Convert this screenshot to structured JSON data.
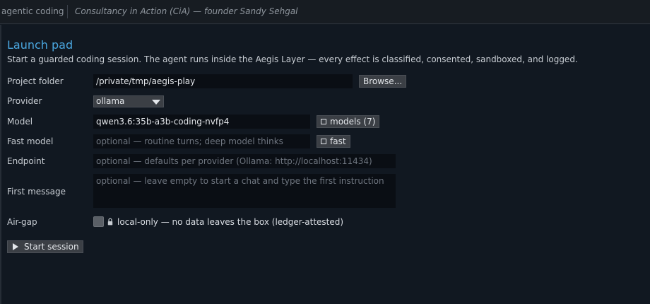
{
  "topbar": {
    "app_title": "agentic coding",
    "subtitle": "Consultancy in Action (CiA) — founder Sandy Sehgal"
  },
  "launch": {
    "heading": "Launch pad",
    "intro": "Start a guarded coding session. The agent runs inside the Aegis Layer — every effect is classified, consented, sandboxed, and logged."
  },
  "form": {
    "project_folder": {
      "label": "Project folder",
      "value": "/private/tmp/aegis-play",
      "browse_label": "Browse..."
    },
    "provider": {
      "label": "Provider",
      "selected": "ollama"
    },
    "model": {
      "label": "Model",
      "value": "qwen3.6:35b-a3b-coding-nvfp4",
      "models_button": "models (7)"
    },
    "fast_model": {
      "label": "Fast model",
      "placeholder": "optional — routine turns; deep model thinks",
      "fast_button": "fast"
    },
    "endpoint": {
      "label": "Endpoint",
      "placeholder": "optional — defaults per provider (Ollama: http://localhost:11434)"
    },
    "first_message": {
      "label": "First message",
      "placeholder": "optional — leave empty to start a chat and type the first instruction"
    },
    "airgap": {
      "label": "Air-gap",
      "checked": false,
      "text": "local-only — no data leaves the box (ledger-attested)"
    }
  },
  "actions": {
    "start_label": "Start session"
  }
}
